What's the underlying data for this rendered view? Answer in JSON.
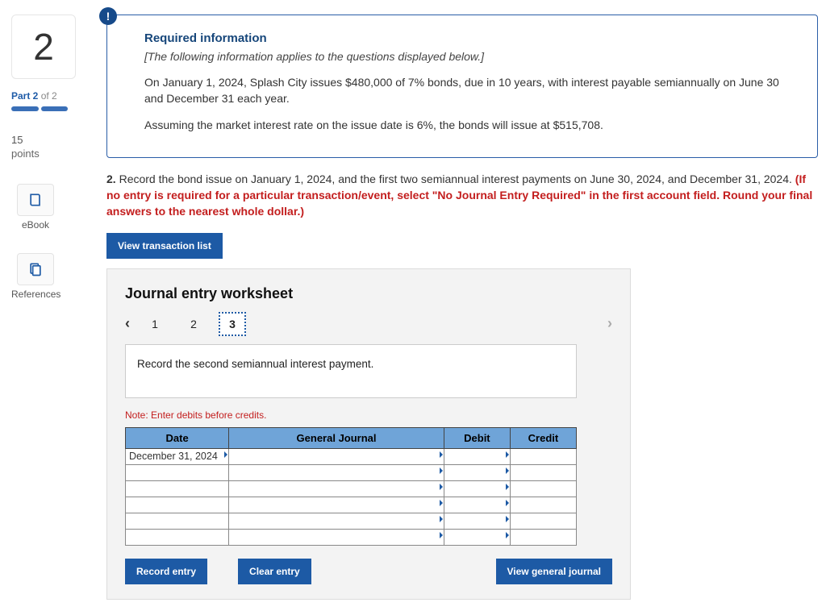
{
  "sidebar": {
    "question_number": "2",
    "part_label": "Part 2",
    "part_of": "of 2",
    "points_value": "15",
    "points_label": "points",
    "ebook_label": "eBook",
    "references_label": "References"
  },
  "info": {
    "badge": "!",
    "heading": "Required information",
    "subtext": "[The following information applies to the questions displayed below.]",
    "para1": "On January 1, 2024, Splash City issues $480,000 of 7% bonds, due in 10 years, with interest payable semiannually on June 30 and December 31 each year.",
    "para2": "Assuming the market interest rate on the issue date is 6%, the bonds will issue at $515,708."
  },
  "question": {
    "num": "2.",
    "text_a": " Record the bond issue on January 1, 2024, and the first two semiannual interest payments on June 30, 2024, and December 31, 2024. ",
    "text_red": "(If no entry is required for a particular transaction/event, select \"No Journal Entry Required\" in the first account field. Round your final answers to the nearest whole dollar.)"
  },
  "buttons": {
    "view_list": "View transaction list",
    "record": "Record entry",
    "clear": "Clear entry",
    "view_journal": "View general journal"
  },
  "worksheet": {
    "title": "Journal entry worksheet",
    "steps": [
      "1",
      "2",
      "3"
    ],
    "active_step_index": 2,
    "instruction": "Record the second semiannual interest payment.",
    "note": "Note: Enter debits before credits.",
    "headers": {
      "date": "Date",
      "gj": "General Journal",
      "debit": "Debit",
      "credit": "Credit"
    },
    "rows": [
      {
        "date": "December 31, 2024",
        "gj": "",
        "debit": "",
        "credit": ""
      },
      {
        "date": "",
        "gj": "",
        "debit": "",
        "credit": ""
      },
      {
        "date": "",
        "gj": "",
        "debit": "",
        "credit": ""
      },
      {
        "date": "",
        "gj": "",
        "debit": "",
        "credit": ""
      },
      {
        "date": "",
        "gj": "",
        "debit": "",
        "credit": ""
      },
      {
        "date": "",
        "gj": "",
        "debit": "",
        "credit": ""
      }
    ]
  }
}
